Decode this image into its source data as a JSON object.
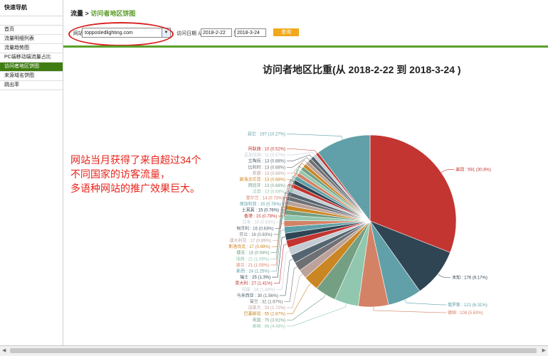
{
  "sidebar": {
    "title": "快速导航",
    "items": [
      {
        "label": "首页",
        "active": false
      },
      {
        "label": "流量明细列表",
        "active": false
      },
      {
        "label": "流量趋势图",
        "active": false
      },
      {
        "label": "PC端移动端流量占比",
        "active": false
      },
      {
        "label": "访问者地区饼图",
        "active": true
      },
      {
        "label": "来源域名饼图",
        "active": false
      },
      {
        "label": "跳出率",
        "active": false
      }
    ]
  },
  "breadcrumb": {
    "parent": "流量",
    "separator": ">",
    "current": "访问者地区饼图"
  },
  "filters": {
    "site_label": "网站",
    "site_value": "topposledlighting.com",
    "date_label": "访问日期 从",
    "from_date": "2018-2-22",
    "to_label": "到",
    "to_date": "2018-3-24",
    "query_button": "查询"
  },
  "annotation": {
    "lines": [
      "网站当月获得了来自超过34个",
      "不同国家的访客流量，",
      "多语种网站的推广效果巨大。"
    ]
  },
  "colors": {
    "accent_green": "#5aa02a",
    "active_nav": "#3f7d12",
    "annotation_red": "#e8231b",
    "query_button": "#f2a81d"
  },
  "chart_data": {
    "type": "pie",
    "title": "访问者地区比重(从 2018-2-22 到 2018-3-24 )",
    "slices": [
      {
        "label": "美国",
        "value": 591,
        "percent": "30.8%",
        "color": "#c23531"
      },
      {
        "label": "未知",
        "value": 176,
        "percent": "9.17%",
        "color": "#2f4554"
      },
      {
        "label": "俄罗斯",
        "value": 121,
        "percent": "6.31%",
        "color": "#61a0a8"
      },
      {
        "label": "德国",
        "value": 108,
        "percent": "5.63%",
        "color": "#d48265"
      },
      {
        "label": "泰国",
        "value": 86,
        "percent": "4.48%",
        "color": "#91c7ae"
      },
      {
        "label": "英国",
        "value": 75,
        "percent": "3.91%",
        "color": "#749f83"
      },
      {
        "label": "巴基斯坦",
        "value": 55,
        "percent": "2.87%",
        "color": "#ca8622"
      },
      {
        "label": "加拿大",
        "value": 33,
        "percent": "1.72%",
        "color": "#bda29a"
      },
      {
        "label": "荷兰",
        "value": 32,
        "percent": "1.67%",
        "color": "#6e7074"
      },
      {
        "label": "马来西亚",
        "value": 30,
        "percent": "1.56%",
        "color": "#546570"
      },
      {
        "label": "印度",
        "value": 28,
        "percent": "1.46%",
        "color": "#c4ccd3"
      },
      {
        "label": "意大利",
        "value": 27,
        "percent": "1.41%",
        "color": "#c23531"
      },
      {
        "label": "瑞士",
        "value": 25,
        "percent": "1.3%",
        "color": "#2f4554"
      },
      {
        "label": "新西",
        "value": 24,
        "percent": "1.25%",
        "color": "#61a0a8"
      },
      {
        "label": "波兰",
        "value": 21,
        "percent": "1.09%",
        "color": "#d48265"
      },
      {
        "label": "瑞典",
        "value": 21,
        "percent": "1.09%",
        "color": "#91c7ae"
      },
      {
        "label": "捷克",
        "value": 18,
        "percent": "0.94%",
        "color": "#749f83"
      },
      {
        "label": "斯洛伐克",
        "value": 17,
        "percent": "0.89%",
        "color": "#ca8622"
      },
      {
        "label": "澳大利亚",
        "value": 17,
        "percent": "0.89%",
        "color": "#bda29a"
      },
      {
        "label": "芬兰",
        "value": 16,
        "percent": "0.83%",
        "color": "#6e7074"
      },
      {
        "label": "匈牙利",
        "value": 16,
        "percent": "0.83%",
        "color": "#546570"
      },
      {
        "label": "日本",
        "value": 16,
        "percent": "0.83%",
        "color": "#c4ccd3"
      },
      {
        "label": "香港",
        "value": 15,
        "percent": "0.78%",
        "color": "#c23531"
      },
      {
        "label": "土耳其",
        "value": 15,
        "percent": "0.78%",
        "color": "#2f4554"
      },
      {
        "label": "保加利亚",
        "value": 15,
        "percent": "0.78%",
        "color": "#61a0a8"
      },
      {
        "label": "爱尔兰",
        "value": 14,
        "percent": "0.73%",
        "color": "#d48265"
      },
      {
        "label": "法国",
        "value": 13,
        "percent": "0.68%",
        "color": "#91c7ae"
      },
      {
        "label": "西班牙",
        "value": 13,
        "percent": "0.68%",
        "color": "#749f83"
      },
      {
        "label": "斯洛文尼亚",
        "value": 13,
        "percent": "0.68%",
        "color": "#ca8622"
      },
      {
        "label": "希腊",
        "value": 13,
        "percent": "0.68%",
        "color": "#bda29a"
      },
      {
        "label": "比利时",
        "value": 13,
        "percent": "0.68%",
        "color": "#6e7074"
      },
      {
        "label": "立陶宛",
        "value": 13,
        "percent": "0.68%",
        "color": "#546570"
      },
      {
        "label": "孟加拉国",
        "value": 11,
        "percent": "0.57%",
        "color": "#c4ccd3"
      },
      {
        "label": "阿联酋",
        "value": 10,
        "percent": "0.52%",
        "color": "#c23531"
      },
      {
        "label": "其它",
        "value": 197,
        "percent": "10.27%",
        "color": "#61a0a8"
      }
    ]
  }
}
